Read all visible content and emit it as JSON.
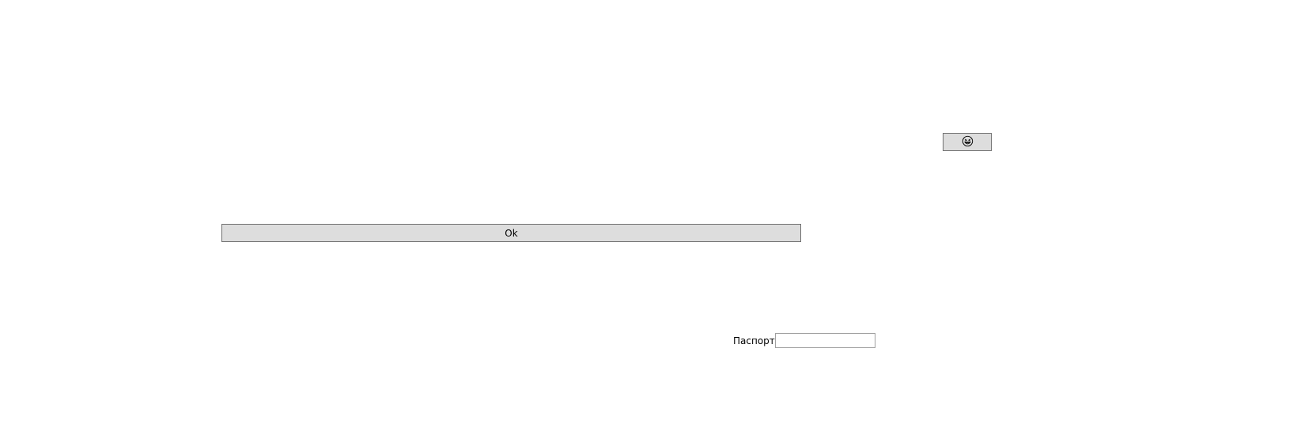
{
  "emoji_button": {
    "icon": "grinning-squinting-face-icon"
  },
  "ok_button": {
    "label": "Ok"
  },
  "passport_field": {
    "label": "Паспорт",
    "value": "",
    "placeholder": ""
  }
}
